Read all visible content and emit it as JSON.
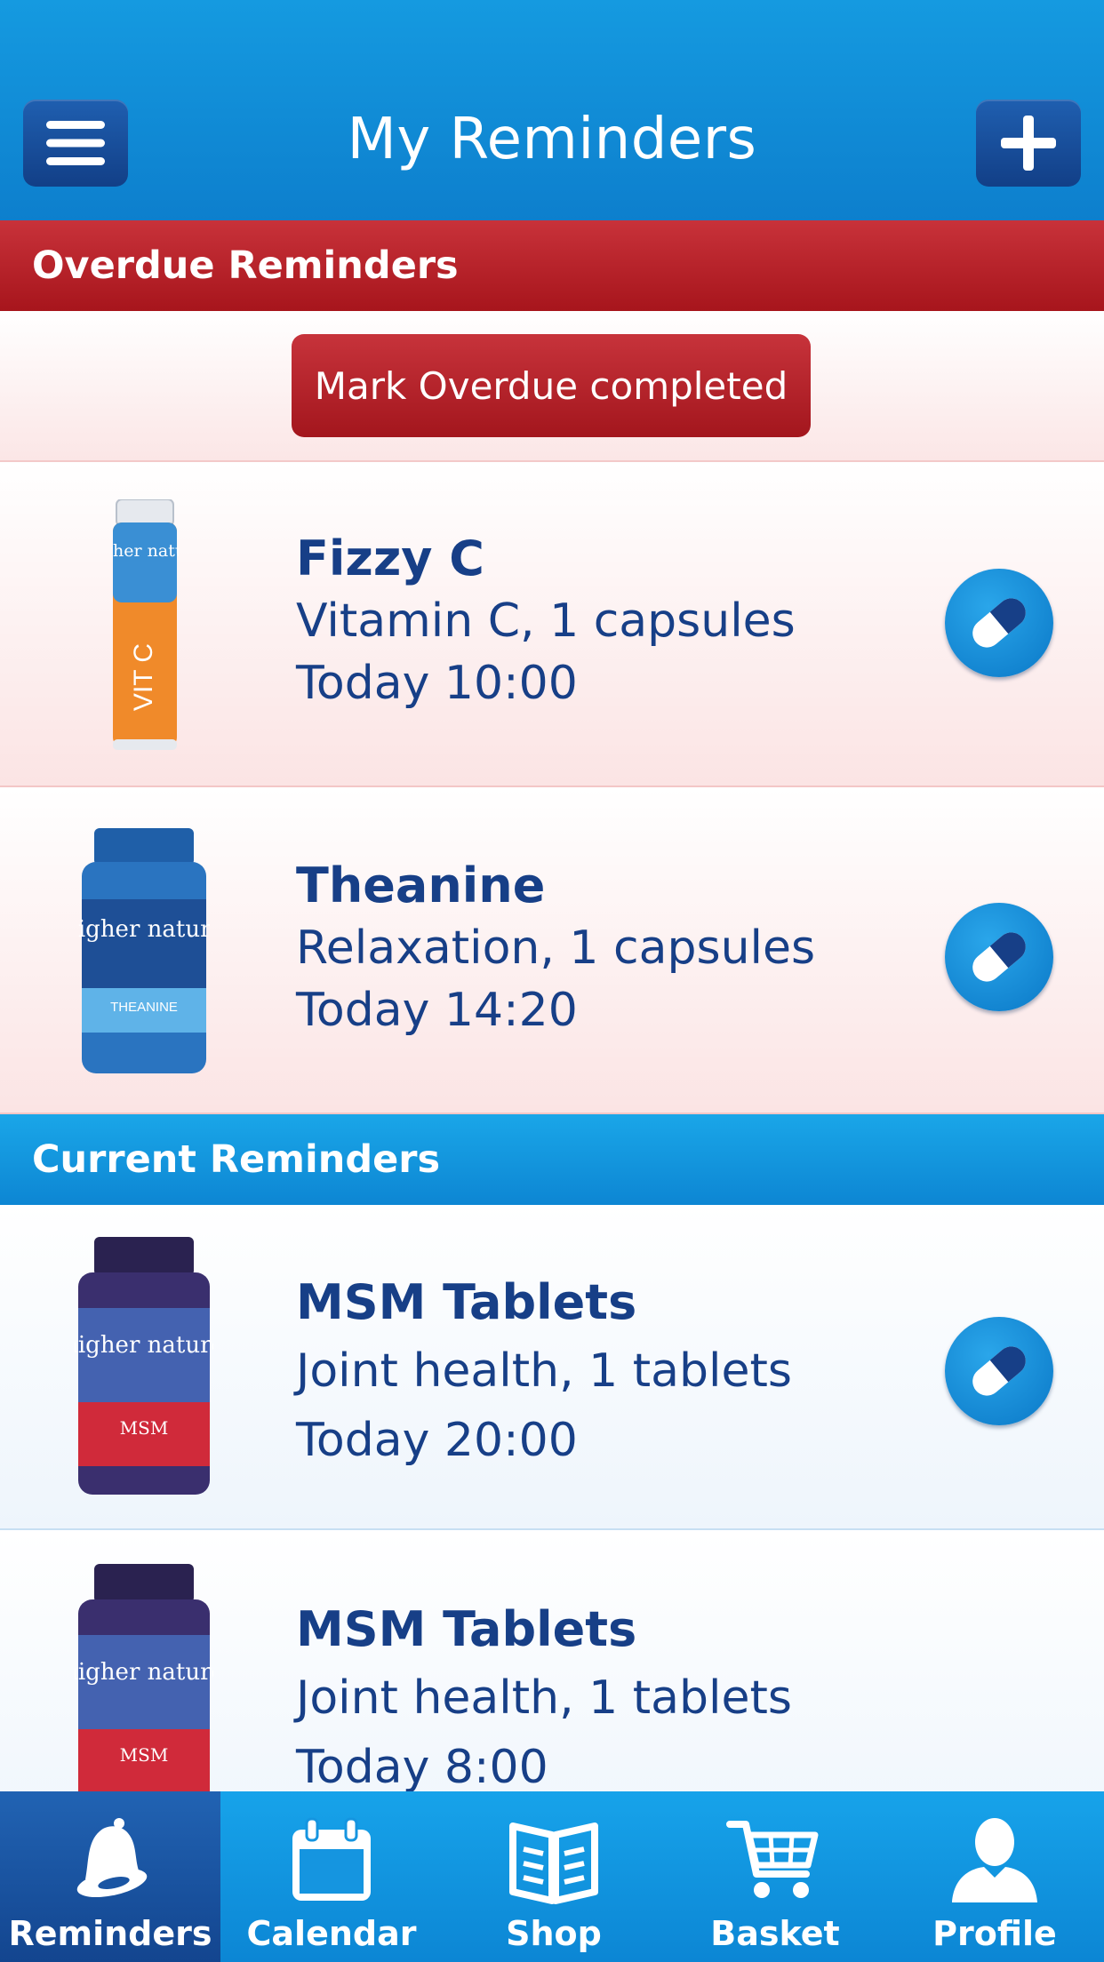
{
  "header": {
    "title": "My Reminders",
    "menu_icon": "hamburger-menu-icon",
    "add_icon": "plus-icon"
  },
  "overdue": {
    "section_title": "Overdue Reminders",
    "mark_button_label": "Mark Overdue completed",
    "items": [
      {
        "name": "Fizzy C",
        "detail": "Vitamin C, 1 capsules",
        "time": "Today 10:00",
        "brand": "higher nature",
        "product_label": "VIT C"
      },
      {
        "name": "Theanine",
        "detail": "Relaxation, 1 capsules",
        "time": "Today 14:20",
        "brand": "higher nature",
        "product_label": "THEANINE"
      }
    ]
  },
  "current": {
    "section_title": "Current Reminders",
    "items": [
      {
        "name": "MSM Tablets",
        "detail": "Joint health, 1 tablets",
        "time": "Today 20:00",
        "brand": "higher nature",
        "product_label": "MSM"
      },
      {
        "name": "MSM Tablets",
        "detail": "Joint health, 1 tablets",
        "time": "Today 8:00",
        "brand": "higher nature",
        "product_label": "MSM"
      }
    ]
  },
  "tabs": [
    {
      "label": "Reminders",
      "icon": "bell-icon",
      "active": true
    },
    {
      "label": "Calendar",
      "icon": "calendar-icon",
      "active": false
    },
    {
      "label": "Shop",
      "icon": "book-icon",
      "active": false
    },
    {
      "label": "Basket",
      "icon": "cart-icon",
      "active": false
    },
    {
      "label": "Profile",
      "icon": "person-icon",
      "active": false
    }
  ],
  "colors": {
    "header_blue": "#0d7fcd",
    "overdue_red": "#b01e25",
    "text_navy": "#173f87",
    "tab_active": "#1a55a3"
  }
}
